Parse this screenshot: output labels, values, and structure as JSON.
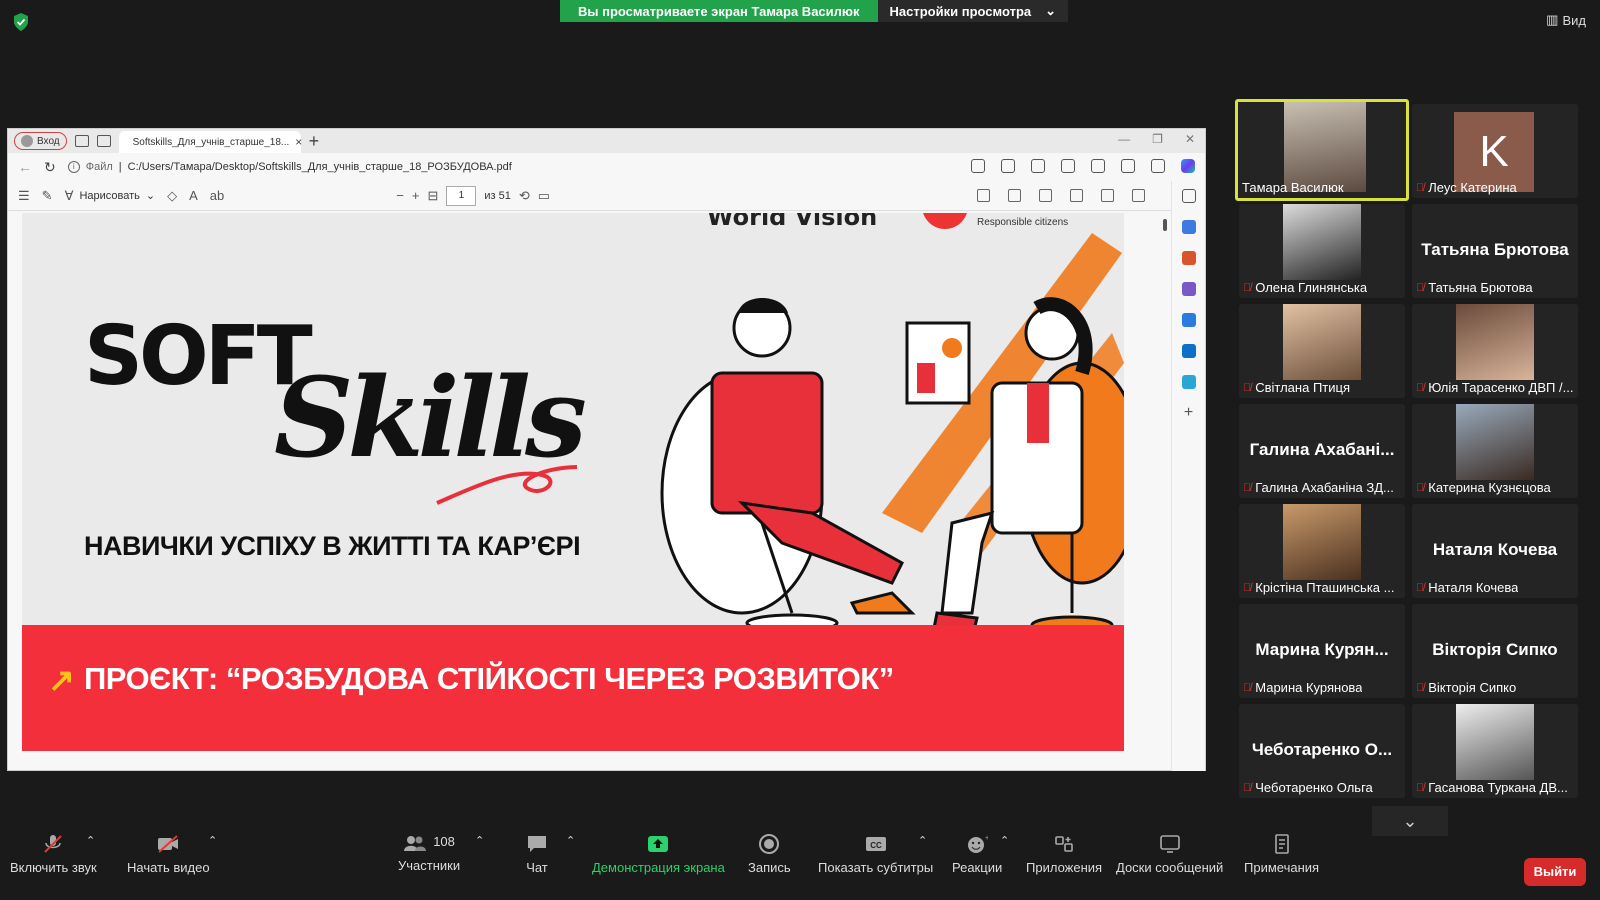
{
  "top": {
    "share_banner": "Вы просматриваете экран Тамара Василюк",
    "view_settings": "Настройки просмотра",
    "view_button": "Вид"
  },
  "browser": {
    "profile_label": "Вход",
    "tab_title": "Softskills_Для_учнів_старше_18...",
    "url_prefix": "Файл",
    "url": "C:/Users/Тамара/Desktop/Softskills_Для_учнів_старше_18_РОЗБУДОВА.pdf",
    "draw_label": "Нарисовать",
    "page_current": "1",
    "page_total": "из 51"
  },
  "slide": {
    "brand_wv": "World Vision",
    "brand_rc": "Responsible citizens",
    "soft": "SOFT",
    "skills": "Skills",
    "subtitle": "НАВИЧКИ УСПІХУ В ЖИТТІ ТА КАР’ЄРІ",
    "project": "ПРОЄКТ: “РОЗБУДОВА СТІЙКОСТІ ЧЕРЕЗ РОЗВИТОК”"
  },
  "participants": [
    {
      "name": "Тамара Василюк",
      "display": "",
      "kind": "video",
      "muted": false
    },
    {
      "name": "Леус Катерина",
      "display": "K",
      "kind": "letter",
      "muted": true
    },
    {
      "name": "Олена Глинянська",
      "display": "",
      "kind": "video",
      "muted": true
    },
    {
      "name": "Татьяна Брютова",
      "display": "Татьяна Брютова",
      "kind": "name",
      "muted": true
    },
    {
      "name": "Світлана Птиця",
      "display": "",
      "kind": "video",
      "muted": true
    },
    {
      "name": "Юлія Тарасенко ДВП /...",
      "display": "",
      "kind": "video",
      "muted": true
    },
    {
      "name": "Галина Ахабаніна ЗД...",
      "display": "Галина Ахабані...",
      "kind": "name",
      "muted": true
    },
    {
      "name": "Катерина Кузнєцова",
      "display": "",
      "kind": "video",
      "muted": true
    },
    {
      "name": "Крістіна Пташинська ...",
      "display": "",
      "kind": "video",
      "muted": true
    },
    {
      "name": "Наталя Кочева",
      "display": "Наталя Кочева",
      "kind": "name",
      "muted": true
    },
    {
      "name": "Марина Курянова",
      "display": "Марина Курян...",
      "kind": "name",
      "muted": true
    },
    {
      "name": "Вікторія Сипко",
      "display": "Вікторія Сипко",
      "kind": "name",
      "muted": true
    },
    {
      "name": "Чеботаренко Ольга",
      "display": "Чеботаренко О...",
      "kind": "name",
      "muted": true
    },
    {
      "name": "Гасанова Туркана ДВ...",
      "display": "",
      "kind": "video",
      "muted": true
    }
  ],
  "toolbar": {
    "audio": "Включить звук",
    "video": "Начать видео",
    "participants": "Участники",
    "participants_count": "108",
    "chat": "Чат",
    "share": "Демонстрация экрана",
    "record": "Запись",
    "captions": "Показать субтитры",
    "reactions": "Реакции",
    "apps": "Приложения",
    "whiteboards": "Доски сообщений",
    "notes": "Примечания",
    "leave": "Выйти"
  },
  "colors": {
    "accent_green": "#22a24a",
    "slide_red": "#f22f3a",
    "active_border": "#d9e23c",
    "leave_red": "#d72a2a"
  }
}
